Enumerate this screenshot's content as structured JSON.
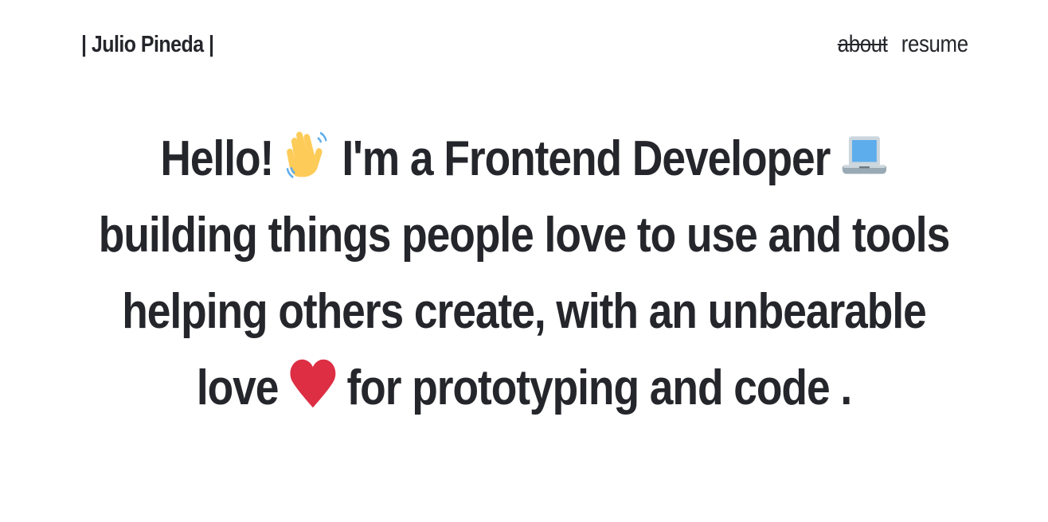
{
  "header": {
    "brand": "| Julio Pineda |",
    "nav": {
      "about": "about",
      "resume": "resume"
    }
  },
  "hero": {
    "part1": "Hello!",
    "part2": "I'm a Frontend Developer",
    "line2": "building things people love to use and tools",
    "line3": "helping others create, with an unbearable",
    "part4a": "love",
    "part4b": "for prototyping and code .",
    "icons": [
      "waving-hand-icon",
      "laptop-icon",
      "heart-icon"
    ]
  },
  "colors": {
    "text": "#25262b",
    "background": "#ffffff",
    "heart": "#dd2e44",
    "hand": "#fdcb58",
    "laptop": "#5dadec"
  }
}
